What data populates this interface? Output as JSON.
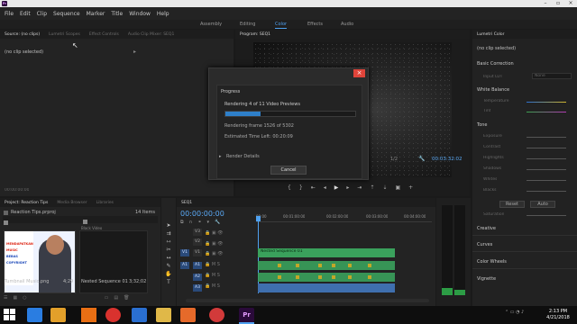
{
  "titlebar": {
    "logo": "Pr",
    "title": ""
  },
  "menu": [
    "File",
    "Edit",
    "Clip",
    "Sequence",
    "Marker",
    "Title",
    "Window",
    "Help"
  ],
  "workspaces": {
    "items": [
      "Assembly",
      "Editing",
      "Color",
      "Effects",
      "Audio"
    ],
    "active": "Color"
  },
  "source_panel": {
    "tabs": [
      "Source: (no clips)",
      "Lumetri Scopes",
      "Effect Controls",
      "Audio Clip Mixer: SEQ1"
    ],
    "active_tab": 0,
    "no_clip": "(no clip selected)",
    "timecode": "00:00:00:00"
  },
  "program_panel": {
    "tab": "Program: SEQ1",
    "timecode_right": "00:03:32:02",
    "scale": "1/2"
  },
  "render_dialog": {
    "heading": "Progress",
    "status": "Rendering 4 of 11 Video Previews",
    "progress": 0.27,
    "frame": "Rendering frame 1526 of 5302",
    "time_left": "Estimated Time Left: 00:20:09",
    "details": "Render Details",
    "cancel": "Cancel"
  },
  "lumetri": {
    "tab": "Lumetri Color",
    "no_clip": "(no clip selected)",
    "basic_correction": "Basic Correction",
    "input_lut_label": "Input LUT",
    "input_lut_value": "None",
    "white_balance": "White Balance",
    "wb_rows": [
      "Temperature",
      "Tint"
    ],
    "tone": "Tone",
    "tone_rows": [
      "Exposure",
      "Contrast",
      "Highlights",
      "Shadows",
      "Whites",
      "Blacks"
    ],
    "reset": "Reset",
    "auto": "Auto",
    "saturation": "Saturation",
    "sections": [
      "Creative",
      "Curves",
      "Color Wheels",
      "Vignette"
    ]
  },
  "project_panel": {
    "tabs": [
      "Project: Reaction Tips",
      "Media Browser",
      "Libraries"
    ],
    "active_tab": 0,
    "file": "Reaction Tips.prproj",
    "items_count": "14 Items",
    "folder_label": "Black Video",
    "items": [
      {
        "name": "Tumbnail Music.png",
        "dur": "4;29"
      },
      {
        "name": "Nested Sequence 01",
        "dur": "3;32;02"
      }
    ],
    "thumb_text": [
      "MENDAPATKAN",
      "MUSIC",
      "BEBAS",
      "COPYRIGHT"
    ]
  },
  "timeline": {
    "tab": "SEQ1",
    "timecode": "00:00:00:00",
    "ruler": [
      "00:00",
      "00:01:00:00",
      "00:02:00:00",
      "00:03:00:00",
      "00:04:00:00"
    ],
    "video_tracks": [
      "V3",
      "V2",
      "V1"
    ],
    "audio_tracks": [
      "A1",
      "A2",
      "A3"
    ],
    "clip_label": "Nested Sequence 01"
  },
  "taskbar": {
    "time": "2:13 PM",
    "date": "4/21/2018"
  },
  "colors": {
    "accent": "#4fa1f0",
    "progress": "#2e7fc9",
    "clip_video": "#3aa15c",
    "clip_audio": "#3f6fae",
    "close": "#e0443a"
  }
}
